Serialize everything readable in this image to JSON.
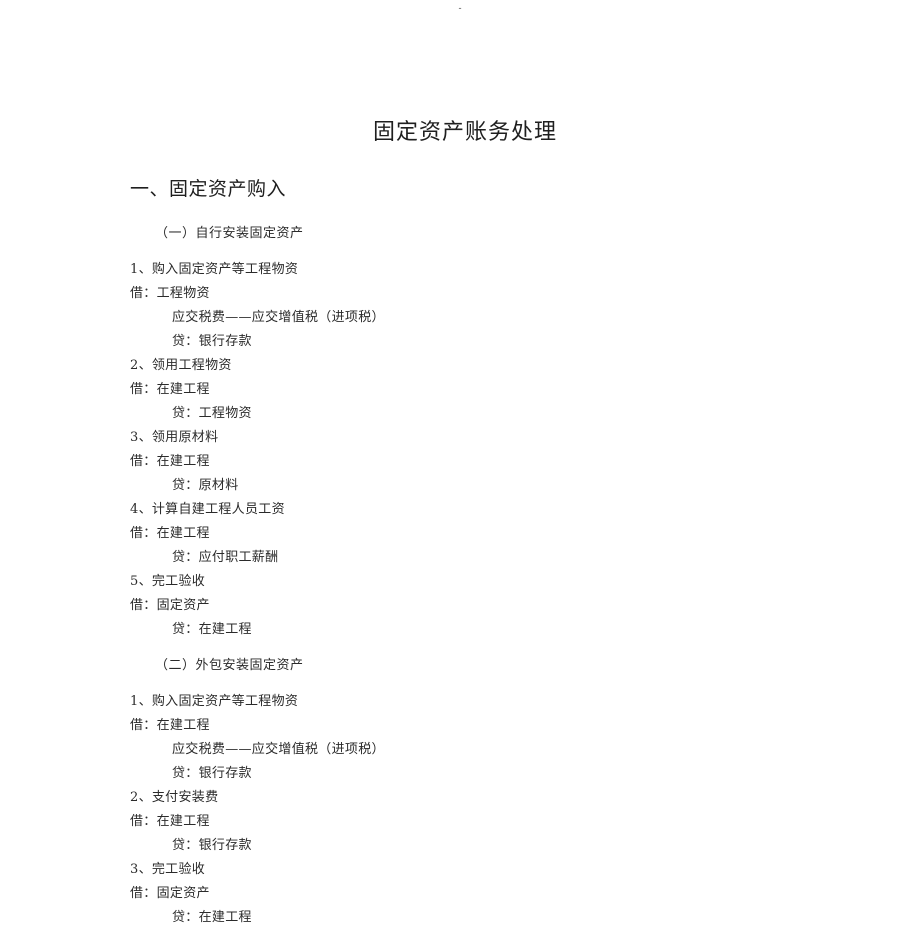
{
  "header": {
    "mark": "-"
  },
  "document": {
    "title": "固定资产账务处理",
    "section_heading": "一、固定资产购入",
    "subsections": [
      {
        "heading": "（一）自行安装固定资产",
        "entries": [
          {
            "item": "1、购入固定资产等工程物资",
            "lines": [
              {
                "indent": 0,
                "text": "借：工程物资"
              },
              {
                "indent": 1,
                "text": "应交税费——应交增值税（进项税）"
              },
              {
                "indent": 1,
                "text": "贷：银行存款"
              }
            ]
          },
          {
            "item": "2、领用工程物资",
            "lines": [
              {
                "indent": 0,
                "text": "借：在建工程"
              },
              {
                "indent": 1,
                "text": "贷：工程物资"
              }
            ]
          },
          {
            "item": "3、领用原材料",
            "lines": [
              {
                "indent": 0,
                "text": "借：在建工程"
              },
              {
                "indent": 1,
                "text": "贷：原材料"
              }
            ]
          },
          {
            "item": "4、计算自建工程人员工资",
            "lines": [
              {
                "indent": 0,
                "text": "借：在建工程"
              },
              {
                "indent": 1,
                "text": "贷：应付职工薪酬"
              }
            ]
          },
          {
            "item": "5、完工验收",
            "lines": [
              {
                "indent": 0,
                "text": "借：固定资产"
              },
              {
                "indent": 1,
                "text": "贷：在建工程"
              }
            ]
          }
        ]
      },
      {
        "heading": "（二）外包安装固定资产",
        "entries": [
          {
            "item": "1、购入固定资产等工程物资",
            "lines": [
              {
                "indent": 0,
                "text": "借：在建工程"
              },
              {
                "indent": 1,
                "text": "应交税费——应交增值税（进项税）"
              },
              {
                "indent": 1,
                "text": "贷：银行存款"
              }
            ]
          },
          {
            "item": "2、支付安装费",
            "lines": [
              {
                "indent": 0,
                "text": "借：在建工程"
              },
              {
                "indent": 1,
                "text": "贷：银行存款"
              }
            ]
          },
          {
            "item": "3、完工验收",
            "lines": [
              {
                "indent": 0,
                "text": "借：固定资产"
              },
              {
                "indent": 1,
                "text": "贷：在建工程"
              }
            ]
          }
        ]
      }
    ]
  }
}
